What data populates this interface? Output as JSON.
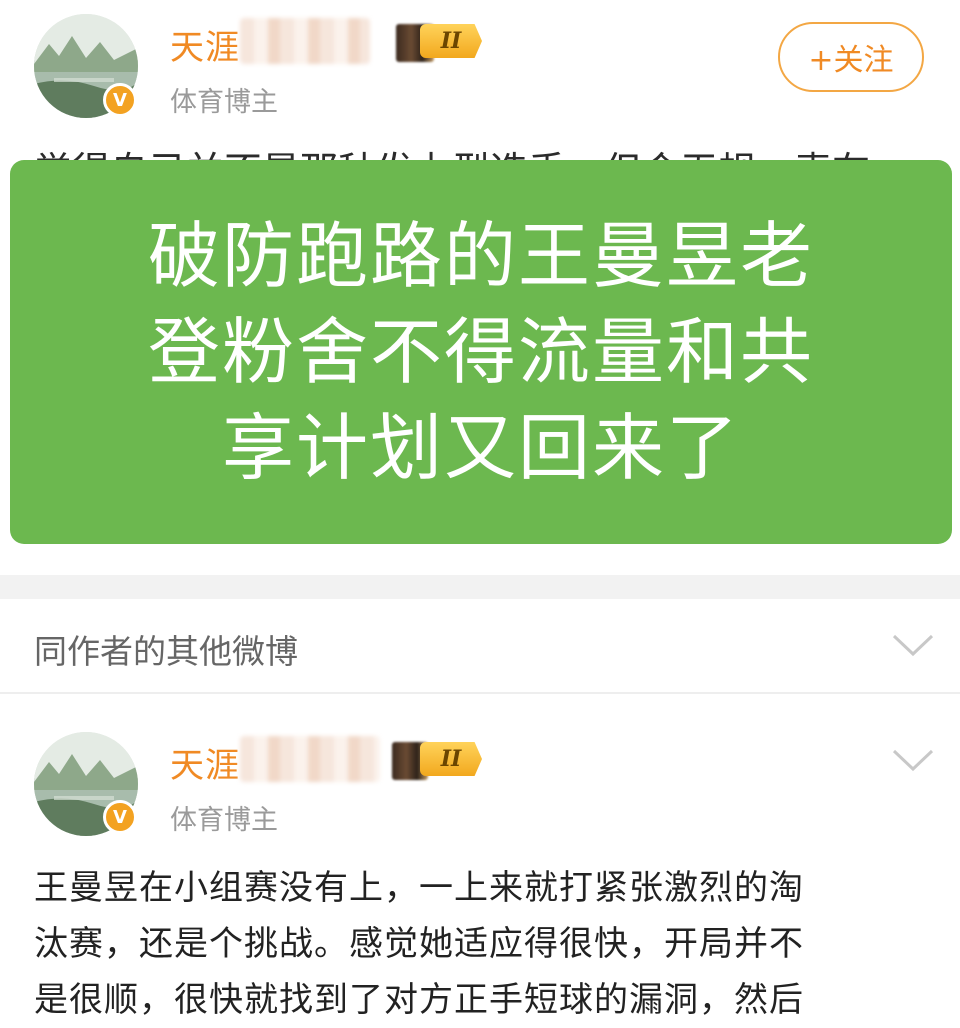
{
  "post1": {
    "username": "天涯",
    "level": "II",
    "subtitle": "体育博主",
    "follow_label": "+关注",
    "hidden_text": "觉得自己并不是那种发力型选手，但会无规，表在"
  },
  "overlay": {
    "lines": [
      "破防跑路的王曼昱老",
      "登粉舍不得流量和共",
      "享计划又回来了"
    ]
  },
  "section": {
    "title": "同作者的其他微博"
  },
  "post2": {
    "username": "天涯",
    "level": "II",
    "subtitle": "体育博主",
    "lines": [
      "王曼昱在小组赛没有上，一上来就打紧张激烈的淘",
      "汰赛，还是个挑战。感觉她适应得很快，开局并不",
      "是很顺，很快就找到了对方正手短球的漏洞，然后"
    ]
  },
  "colors": {
    "accent": "#f08a24",
    "overlay_green": "#6cb84f",
    "badge_gold": "#f2a81e"
  },
  "icons": [
    "verified-v-icon",
    "level-badge-icon",
    "chevron-down-icon"
  ]
}
